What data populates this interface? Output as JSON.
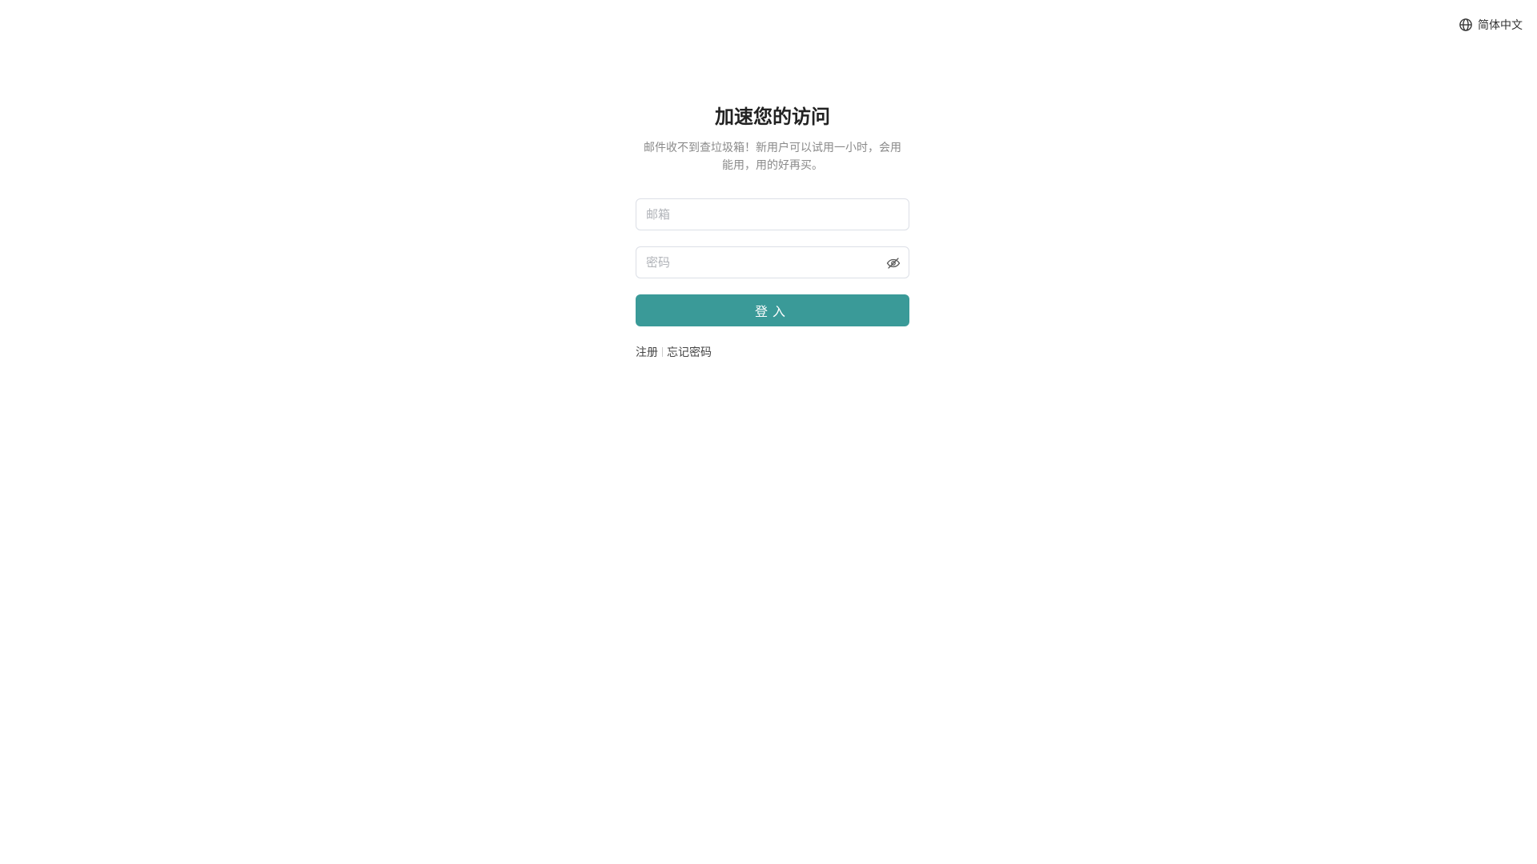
{
  "header": {
    "language_label": "简体中文",
    "language_icon": "globe-icon"
  },
  "login": {
    "title": "加速您的访问",
    "subtitle": "邮件收不到查垃圾箱！新用户可以试用一小时，会用能用，用的好再买。",
    "email_placeholder": "邮箱",
    "email_value": "",
    "password_placeholder": "密码",
    "password_value": "",
    "password_toggle_icon": "eye-off-icon",
    "submit_label": "登入",
    "register_link": "注册",
    "forgot_password_link": "忘记密码"
  },
  "colors": {
    "primary_button": "#3a9a98",
    "subtitle_text": "#8a8a8a",
    "input_border": "#dcdfe6"
  }
}
